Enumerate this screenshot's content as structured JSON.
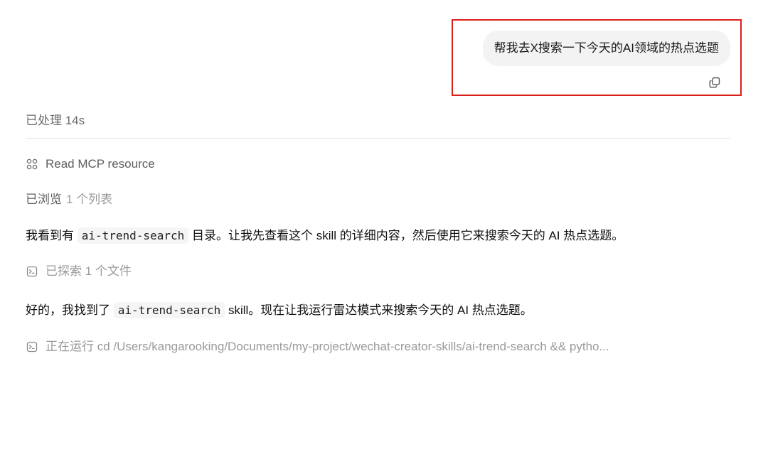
{
  "user_message": {
    "text": "帮我去X搜索一下今天的AI领域的热点选题"
  },
  "process": {
    "status_label": "已处理 14s",
    "mcp_label": "Read MCP resource",
    "browsed_label": "已浏览",
    "browsed_count": "1 个列表"
  },
  "assistant": {
    "msg1_pre": "我看到有",
    "msg1_code": "ai-trend-search",
    "msg1_post": "目录。让我先查看这个 skill 的详细内容，然后使用它来搜索今天的 AI 热点选题。",
    "explored_label": "已探索 1 个文件",
    "msg2_pre": "好的，我找到了",
    "msg2_code": "ai-trend-search",
    "msg2_post": "skill。现在让我运行雷达模式来搜索今天的 AI 热点选题。",
    "running_label": "正在运行 cd /Users/kangarooking/Documents/my-project/wechat-creator-skills/ai-trend-search && pytho..."
  },
  "icons": {
    "copy": "copy-icon",
    "mcp": "mcp-grid-icon",
    "terminal": "terminal-icon"
  },
  "colors": {
    "highlight_outline": "#d9201a",
    "bubble_bg": "#f3f3f3",
    "muted_text": "#9a9a9a"
  }
}
